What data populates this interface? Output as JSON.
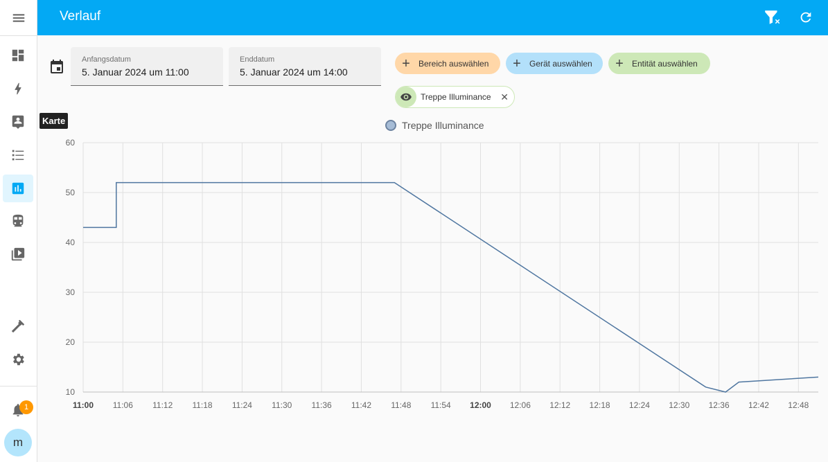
{
  "header": {
    "title": "Verlauf"
  },
  "sidebar": {
    "items": [
      {
        "icon": "dashboard-icon"
      },
      {
        "icon": "energy-icon"
      },
      {
        "icon": "map-icon"
      },
      {
        "icon": "logbook-icon"
      },
      {
        "icon": "history-icon"
      },
      {
        "icon": "train-icon"
      },
      {
        "icon": "media-icon"
      }
    ],
    "tooltip": "Karte",
    "notification_count": "1",
    "avatar_initial": "m"
  },
  "date_range": {
    "start_label": "Anfangsdatum",
    "start_value": "5. Januar 2024 um 11:00",
    "end_label": "Enddatum",
    "end_value": "5. Januar 2024 um 14:00"
  },
  "filters": {
    "area_label": "Bereich auswählen",
    "device_label": "Gerät auswählen",
    "entity_label": "Entität auswählen",
    "selected_entity": "Treppe Illuminance"
  },
  "colors": {
    "accent": "#03a9f4",
    "area_chip": "#ffd7a8",
    "device_chip": "#b3e0fa",
    "entity_chip": "#cde8b7",
    "line": "#4f76a0"
  },
  "chart_data": {
    "type": "line",
    "step": true,
    "legend": [
      "Treppe Illuminance"
    ],
    "series": [
      {
        "name": "Treppe Illuminance",
        "x": [
          "11:00",
          "11:05",
          "11:05",
          "11:47",
          "11:47",
          "12:34",
          "12:34",
          "12:37",
          "12:37",
          "12:39",
          "12:39",
          "12:51"
        ],
        "values": [
          43,
          43,
          52,
          52,
          52,
          11,
          11,
          10,
          10,
          12,
          12,
          13
        ]
      }
    ],
    "ylim": [
      10,
      60
    ],
    "yticks": [
      "60",
      "50",
      "40",
      "30",
      "20",
      "10"
    ],
    "xticks": [
      "11:00",
      "11:06",
      "11:12",
      "11:18",
      "11:24",
      "11:30",
      "11:36",
      "11:42",
      "11:48",
      "11:54",
      "12:00",
      "12:06",
      "12:12",
      "12:18",
      "12:24",
      "12:30",
      "12:36",
      "12:42",
      "12:48"
    ],
    "bold_xticks": [
      "11:00",
      "12:00"
    ],
    "grid": true
  }
}
